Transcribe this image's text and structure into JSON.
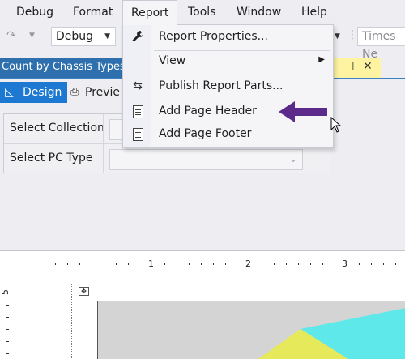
{
  "menubar": {
    "items": [
      "Debug",
      "Format",
      "Report",
      "Tools",
      "Window",
      "Help"
    ]
  },
  "toolbar": {
    "config_label": "Debug",
    "font_combo": "Times Ne"
  },
  "document": {
    "tab_title": "Count by Chassis Types",
    "pin_icon": "pin-icon",
    "close_icon": "close-icon"
  },
  "view_tabs": {
    "design": "Design",
    "preview": "Previe"
  },
  "parameters": [
    {
      "label": "Select Collection",
      "value": ""
    },
    {
      "label": "Select PC Type",
      "value": ""
    }
  ],
  "ruler": {
    "h_numbers": [
      "1",
      "2",
      "3"
    ],
    "v_number": "5"
  },
  "report_menu": {
    "items": [
      {
        "label": "Report Properties...",
        "icon": "wrench-icon"
      },
      {
        "label": "View",
        "icon": "",
        "submenu": true
      },
      {
        "label": "Publish Report Parts...",
        "icon": "publish-icon"
      },
      {
        "label": "Add Page Header",
        "icon": "page-header-icon"
      },
      {
        "label": "Add Page Footer",
        "icon": "page-footer-icon"
      }
    ]
  },
  "colors": {
    "accent_blue": "#1c78d0",
    "doc_tab_blue": "#2e6fae",
    "arrow_purple": "#5b2a8a",
    "chart_cyan": "#5ee8ea",
    "chart_yellow": "#e6ea5a"
  }
}
